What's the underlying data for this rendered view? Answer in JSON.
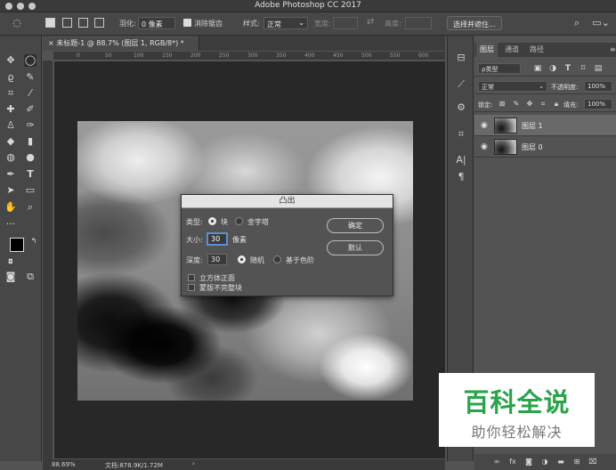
{
  "app": {
    "title": "Adobe Photoshop CC 2017"
  },
  "options_bar": {
    "feather_label": "羽化:",
    "feather_value": "0 像素",
    "antialias_label": "消除锯齿",
    "style_label": "样式:",
    "style_value": "正常",
    "width_label": "宽度:",
    "height_label": "高度:",
    "select_mask_button": "选择并遮住..."
  },
  "document": {
    "tab_label": "未标题-1 @ 88.7% (图层 1, RGB/8*) *",
    "ruler_ticks": [
      "0",
      "50",
      "100",
      "150",
      "200",
      "250",
      "300",
      "350",
      "400",
      "450",
      "500",
      "550",
      "600"
    ]
  },
  "dialog": {
    "title": "凸出",
    "type_label": "类型:",
    "type_option_block": "块",
    "type_option_pyramid": "金字塔",
    "size_label": "大小:",
    "size_value": "30",
    "size_unit": "像素",
    "depth_label": "深度:",
    "depth_value": "30",
    "depth_option_random": "随机",
    "depth_option_level": "基于色阶",
    "solid_front_faces": "立方体正面",
    "mask_incomplete": "蒙版不完整块",
    "ok_button": "确定",
    "default_button": "默认"
  },
  "layers_panel": {
    "tabs": [
      "图层",
      "通道",
      "路径"
    ],
    "filter_label": "ρ类型",
    "blend_mode": "正常",
    "opacity_label": "不透明度:",
    "opacity_value": "100%",
    "lock_label": "锁定:",
    "fill_label": "填充:",
    "fill_value": "100%",
    "layers": [
      "图层 1",
      "图层 0"
    ]
  },
  "status_bar": {
    "zoom": "88.69%",
    "doc_info": "文档:878.9K/1.72M"
  },
  "watermark": {
    "title": "百科全说",
    "subtitle": "助你轻松解决"
  }
}
